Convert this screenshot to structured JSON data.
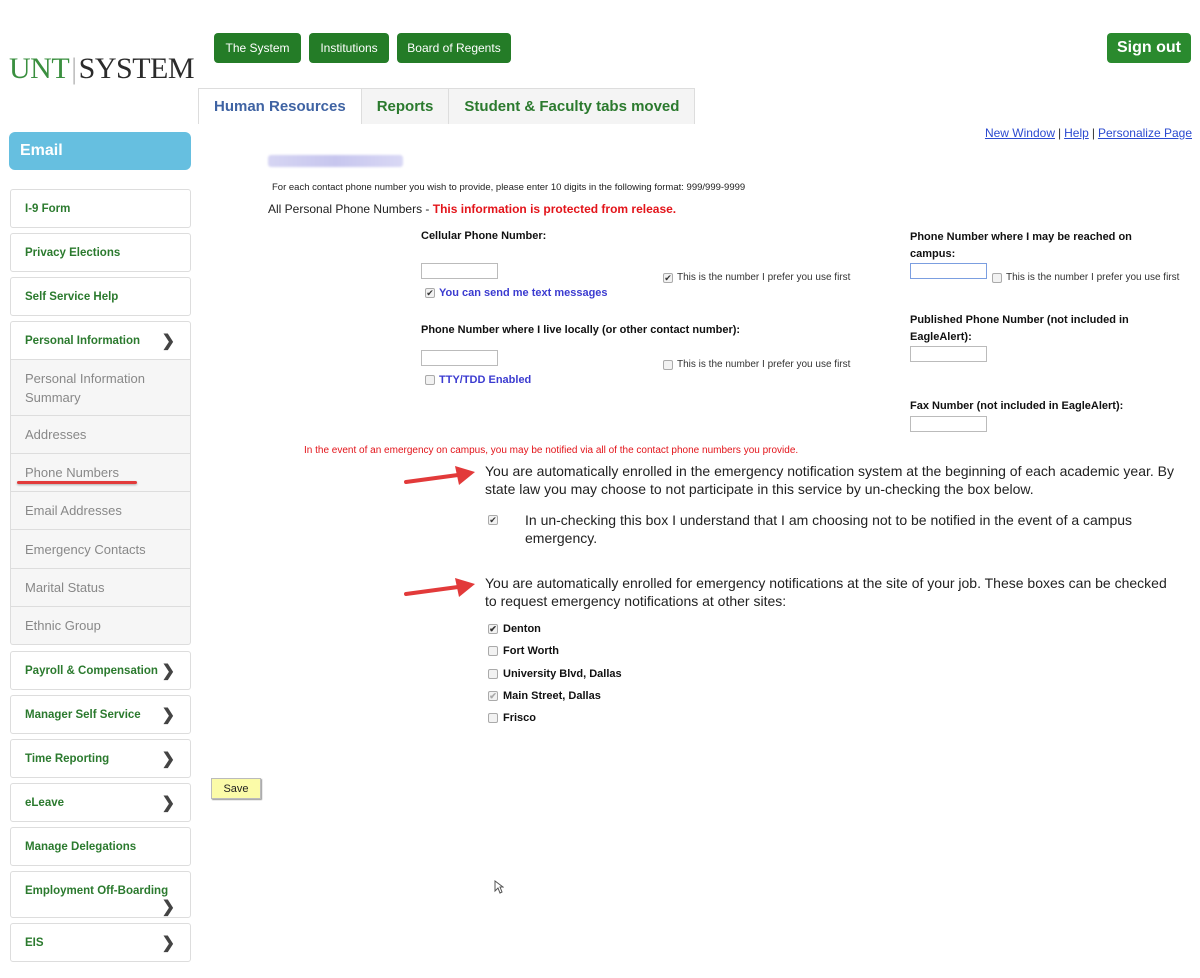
{
  "logo": {
    "left": "UNT",
    "right": "SYSTEM"
  },
  "top_nav": [
    "The System",
    "Institutions",
    "Board of Regents"
  ],
  "sign_out": "Sign out",
  "tabs": [
    {
      "label": "Human Resources",
      "active": true
    },
    {
      "label": "Reports",
      "active": false
    },
    {
      "label": "Student & Faculty tabs moved",
      "active": false
    }
  ],
  "top_links": [
    "New Window",
    "Help",
    "Personalize Page"
  ],
  "sidebar": {
    "email": "Email",
    "items": [
      {
        "label": "I-9 Form"
      },
      {
        "label": "Privacy Elections"
      },
      {
        "label": "Self Service Help"
      },
      {
        "label": "Personal Information",
        "expandable": true
      },
      {
        "label": "Payroll & Compensation",
        "expandable": true
      },
      {
        "label": "Manager Self Service",
        "expandable": true
      },
      {
        "label": "Time Reporting",
        "expandable": true
      },
      {
        "label": "eLeave",
        "expandable": true
      },
      {
        "label": "Manage Delegations"
      },
      {
        "label": "Employment Off-Boarding",
        "expandable": true
      },
      {
        "label": "EIS",
        "expandable": true
      }
    ],
    "sub_items": [
      "Personal Information Summary",
      "Addresses",
      "Phone Numbers",
      "Email Addresses",
      "Emergency Contacts",
      "Marital Status",
      "Ethnic Group"
    ],
    "highlighted_sub_item": "Phone Numbers"
  },
  "main": {
    "instructions": "For each contact phone number you wish to provide, please enter 10 digits in the following format:  999/999-9999",
    "all_phone_label": "All Personal Phone Numbers - ",
    "protected_notice": "This information is protected from release.",
    "cellular": {
      "label": "Cellular Phone Number:",
      "value": "",
      "prefer_label": "This is the number I prefer you use first",
      "prefer_checked": true,
      "text_label": "You can send me text messages",
      "text_checked": true
    },
    "local": {
      "label": "Phone Number where I live locally (or other contact number):",
      "value": "",
      "prefer_label": "This is the number I prefer you use first",
      "prefer_checked": false,
      "tty_label": "TTY/TDD Enabled",
      "tty_checked": false
    },
    "campus": {
      "label": "Phone Number where I may be reached on campus:",
      "value": "",
      "prefer_label": "This is the number I prefer you use first",
      "prefer_checked": false
    },
    "published": {
      "label": "Published Phone Number (not included in EagleAlert):",
      "value": ""
    },
    "fax": {
      "label": "Fax Number (not included in EagleAlert):",
      "value": ""
    },
    "emergency_notice": "In the event of an emergency on campus, you may be notified via all of the contact phone numbers you provide.",
    "enroll_text": "You are automatically enrolled in the emergency notification system at the beginning of each academic year. By state law you may choose to not participate in this service by un-checking the box below.",
    "optout_text": "In un-checking this box I understand that I am choosing not to be notified in the event of a campus emergency.",
    "optout_checked": true,
    "sites_text": "You are automatically enrolled for emergency notifications at the site of your job. These boxes can be checked to request emergency notifications at other sites:",
    "sites": [
      {
        "label": "Denton",
        "checked": true,
        "disabled": false
      },
      {
        "label": "Fort Worth",
        "checked": false,
        "disabled": false
      },
      {
        "label": "University Blvd, Dallas",
        "checked": false,
        "disabled": false
      },
      {
        "label": "Main Street, Dallas",
        "checked": true,
        "disabled": true
      },
      {
        "label": "Frisco",
        "checked": false,
        "disabled": false
      }
    ],
    "save_label": "Save"
  },
  "colors": {
    "brand_green": "#247c27",
    "email_blue": "#66bfe0",
    "alert_red": "#e3141a",
    "annotation_red": "#e23a3a"
  }
}
